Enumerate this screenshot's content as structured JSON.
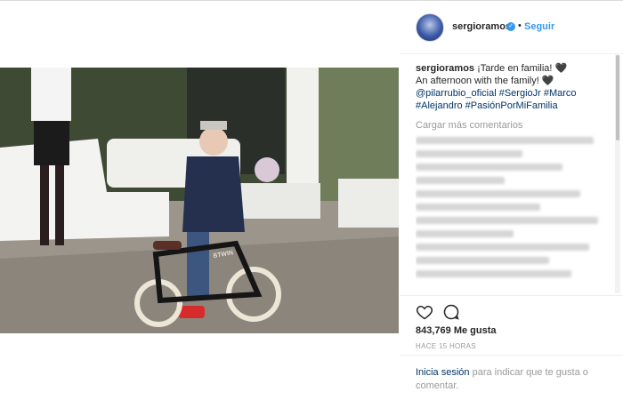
{
  "post": {
    "username": "sergioramos",
    "follow_label": "Seguir",
    "dot": "•",
    "caption_user": "sergioramos",
    "caption_line1": " ¡Tarde en familia! 🖤",
    "caption_line2": "An afternoon with the family! 🖤",
    "tags": [
      "@pilarrubio_oficial",
      "#SergioJr",
      "#Marco",
      "#Alejandro",
      "#PasiónPorMiFamilia"
    ],
    "load_more": "Cargar más comentarios",
    "likes": "843,769 Me gusta",
    "time": "HACE 15 HORAS",
    "login_link": "Inicia sesión",
    "login_rest": " para indicar que te gusta o comentar."
  },
  "photo": {
    "bike_brand": "BTWIN"
  },
  "colors": {
    "link": "#3897f0",
    "tag": "#003569",
    "muted": "#999999",
    "border": "#efefef"
  },
  "icons": {
    "like": "heart-icon",
    "comment": "comment-icon",
    "verified": "verified-badge-icon"
  }
}
